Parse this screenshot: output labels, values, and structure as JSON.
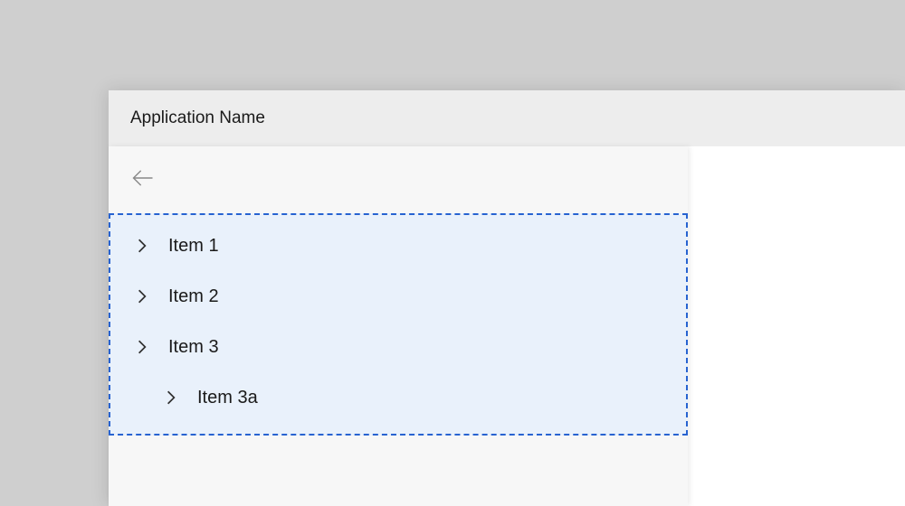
{
  "app": {
    "title": "Application Name"
  },
  "tree": {
    "items": [
      {
        "label": "Item 1",
        "level": 0,
        "expandable": true
      },
      {
        "label": "Item 2",
        "level": 0,
        "expandable": true
      },
      {
        "label": "Item 3",
        "level": 0,
        "expandable": true
      },
      {
        "label": "Item 3a",
        "level": 1,
        "expandable": true
      }
    ]
  },
  "colors": {
    "selection_outline": "#2763d1",
    "selection_fill": "#e9f1fb",
    "panel_bg": "#f7f7f7",
    "titlebar_bg": "#ededed",
    "page_bg": "#cfcfcf"
  }
}
